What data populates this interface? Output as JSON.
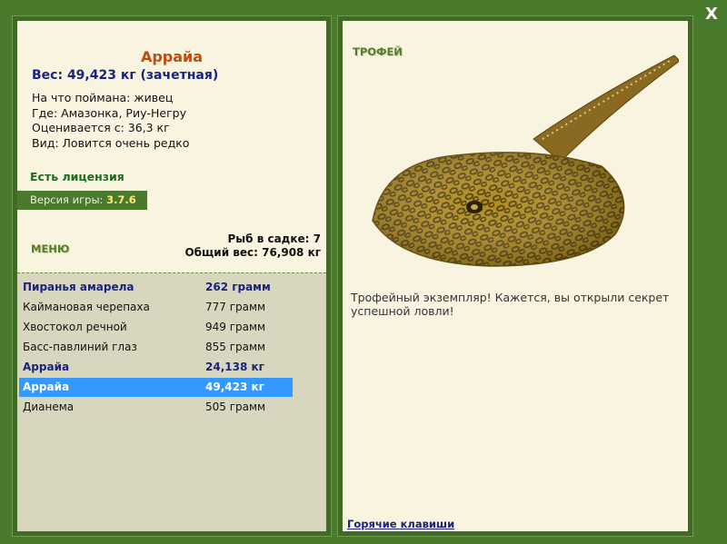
{
  "fish": {
    "name": "Аррайа",
    "weight": "Вес: 49,423 кг (зачетная)",
    "details": [
      "На что поймана: живец",
      "Где: Амазонка, Риу-Негру",
      "Оценивается с: 36,3 кг",
      "Вид: Ловится очень редко"
    ]
  },
  "license": "Есть лицензия",
  "version": {
    "label": "Версия игры:",
    "value": "3.7.6"
  },
  "menu_label": "МЕНЮ",
  "keepnet": {
    "count": "Рыб в садке: 7",
    "total": "Общий вес: 76,908 кг"
  },
  "catch_list": [
    {
      "name": "Пиранья амарела",
      "weight": "262 грамм",
      "trophy": true,
      "selected": false
    },
    {
      "name": "Каймановая черепаха",
      "weight": "777 грамм",
      "trophy": false,
      "selected": false
    },
    {
      "name": "Хвостокол речной",
      "weight": "949 грамм",
      "trophy": false,
      "selected": false
    },
    {
      "name": "Басс-павлиний глаз",
      "weight": "855 грамм",
      "trophy": false,
      "selected": false
    },
    {
      "name": "Аррайа",
      "weight": "24,138 кг",
      "trophy": true,
      "selected": false
    },
    {
      "name": "Аррайа",
      "weight": "49,423 кг",
      "trophy": true,
      "selected": true
    },
    {
      "name": "Дианема",
      "weight": "505 грамм",
      "trophy": false,
      "selected": false
    }
  ],
  "trophy_label": "ТРОФЕЙ",
  "trophy_text": "Трофейный экземпляр! Кажется, вы открыли секрет успешной ловли!",
  "hotkeys_link": "Горячие клавиши",
  "close_label": "X",
  "image_icon": "stingray-image",
  "colors": {
    "background": "#4a7a2c",
    "selected_row": "#3399ff",
    "trophy_text": "#1a237e",
    "fish_title": "#c04a10"
  }
}
